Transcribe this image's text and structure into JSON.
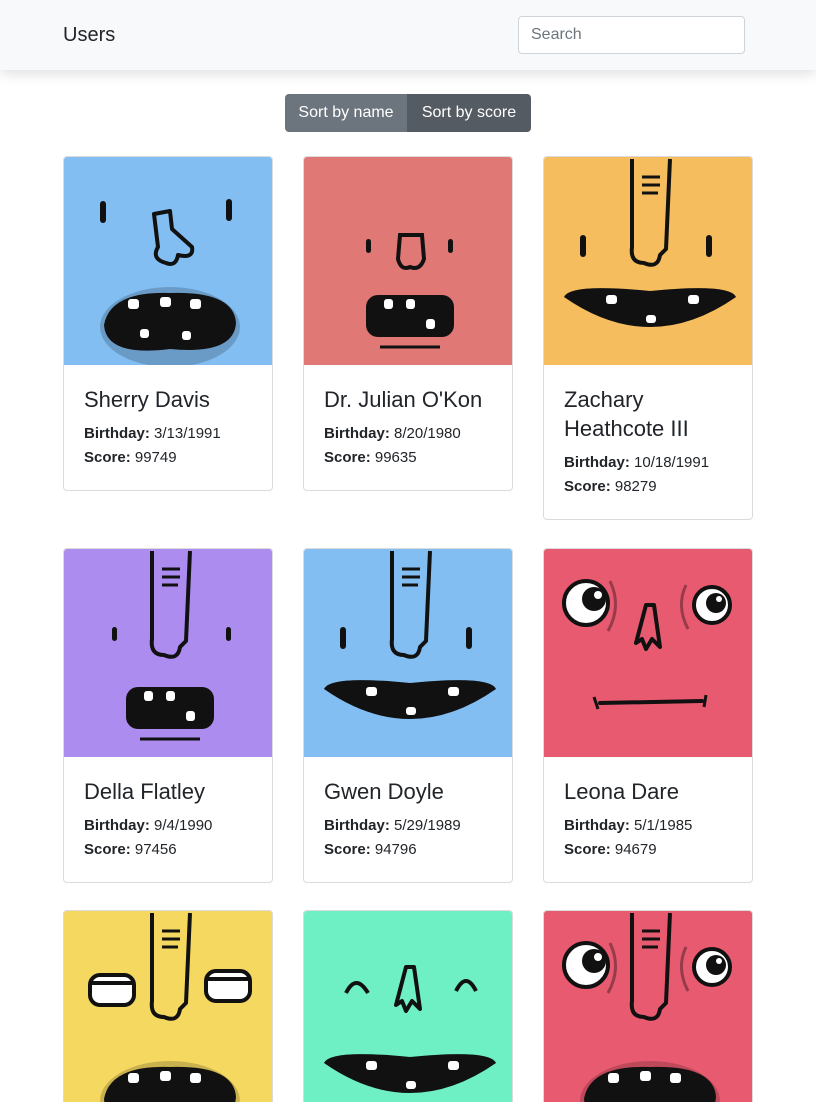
{
  "navbar": {
    "brand": "Users",
    "search_placeholder": "Search"
  },
  "sort": {
    "by_name": "Sort by name",
    "by_score": "Sort by score"
  },
  "labels": {
    "birthday": "Birthday:",
    "score": "Score:"
  },
  "users": [
    {
      "name": "Sherry Davis",
      "birthday": "3/13/1991",
      "score": "99749",
      "color": "#82bef2",
      "face": "big-mouth-round-nose"
    },
    {
      "name": "Dr. Julian O'Kon",
      "birthday": "8/20/1980",
      "score": "99635",
      "color": "#e07876",
      "face": "small-box-mouth"
    },
    {
      "name": "Zachary Heathcote III",
      "birthday": "10/18/1991",
      "score": "98279",
      "color": "#f5bd5e",
      "face": "long-nose-smile"
    },
    {
      "name": "Della Flatley",
      "birthday": "9/4/1990",
      "score": "97456",
      "color": "#ad8cf0",
      "face": "long-nose-box-mouth"
    },
    {
      "name": "Gwen Doyle",
      "birthday": "5/29/1989",
      "score": "94796",
      "color": "#82bef2",
      "face": "long-nose-smile"
    },
    {
      "name": "Leona Dare",
      "birthday": "5/1/1985",
      "score": "94679",
      "color": "#e85a70",
      "face": "big-eyes-flat-mouth"
    },
    {
      "name": "",
      "birthday": "",
      "score": "",
      "color": "#f5d860",
      "face": "squint-eyes-big-mouth"
    },
    {
      "name": "",
      "birthday": "",
      "score": "",
      "color": "#6ef0c4",
      "face": "arch-eyes-smile"
    },
    {
      "name": "",
      "birthday": "",
      "score": "",
      "color": "#e85a70",
      "face": "big-eyes-big-mouth"
    }
  ]
}
